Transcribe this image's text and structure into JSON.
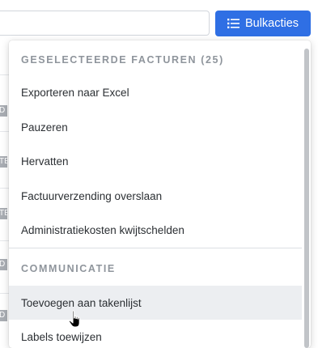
{
  "toolbar": {
    "bulk_button_label": "Bulkacties",
    "bulk_button_icon": "list-icon",
    "accent_color": "#2f6fe4"
  },
  "background_rows": {
    "badges": [
      "D",
      "TE",
      "TE",
      "D",
      "D"
    ]
  },
  "menu": {
    "sections": [
      {
        "header": "GESELECTEERDE FACTUREN (25)",
        "items": [
          "Exporteren naar Excel",
          "Pauzeren",
          "Hervatten",
          "Factuurverzending overslaan",
          "Administratiekosten kwijtschelden"
        ]
      },
      {
        "header": "COMMUNICATIE",
        "items": [
          "Toevoegen aan takenlijst",
          "Labels toewijzen"
        ]
      }
    ],
    "hovered_item": "Toevoegen aan takenlijst"
  }
}
